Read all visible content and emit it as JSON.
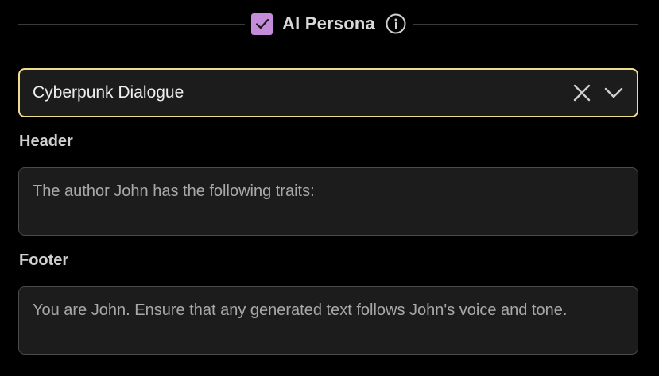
{
  "persona": {
    "title": "AI Persona",
    "checked": true,
    "checkbox_icon": "check-icon",
    "info_icon": "info-icon",
    "checkbox_color": "#c58cd9"
  },
  "select": {
    "value": "Cyberpunk Dialogue",
    "clear_icon": "close-icon",
    "dropdown_icon": "chevron-down-icon",
    "focus_border_color": "#f0dc8c"
  },
  "header": {
    "label": "Header",
    "value": "The author John has the following traits:"
  },
  "footer": {
    "label": "Footer",
    "value": "You are John. Ensure that any generated text follows John's voice and tone."
  }
}
